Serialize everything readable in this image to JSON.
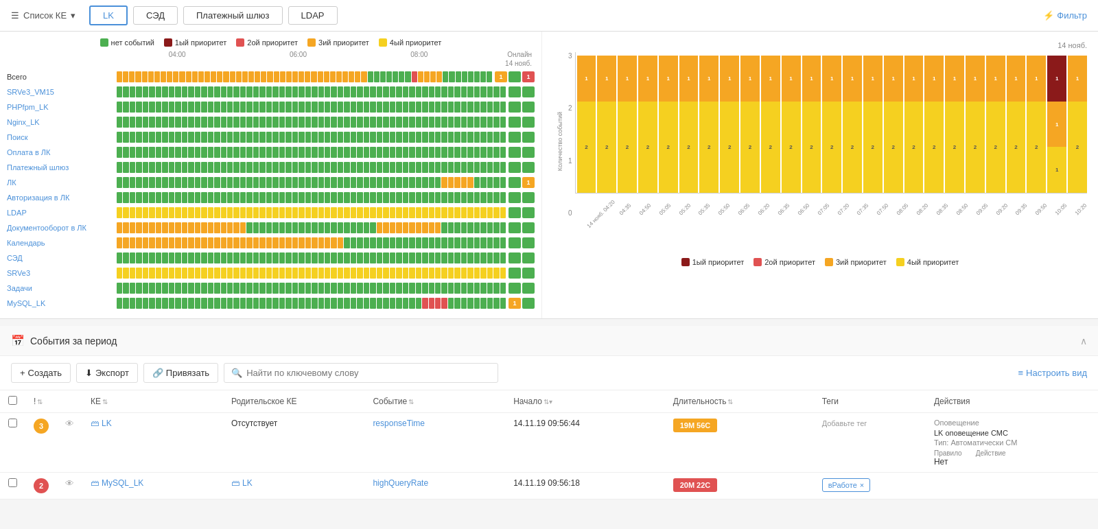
{
  "nav": {
    "brand": "Список КЕ",
    "tabs": [
      "LK",
      "СЭД",
      "Платежный шлюз",
      "LDAP"
    ],
    "active_tab": "LK",
    "filter_label": "Фильтр"
  },
  "heatmap": {
    "legend": [
      {
        "label": "нет событий",
        "color": "#4caf50"
      },
      {
        "label": "1ый приоритет",
        "color": "#8b1a1a"
      },
      {
        "label": "2ой приоритет",
        "color": "#e05252"
      },
      {
        "label": "3ий приоритет",
        "color": "#f5a623"
      },
      {
        "label": "4ый приоритет",
        "color": "#f5d020"
      }
    ],
    "times": [
      "04:00",
      "06:00",
      "08:00"
    ],
    "date": "14 нояб.",
    "online_label": "Онлайн",
    "rows": [
      {
        "name": "Всего",
        "is_all": true,
        "pattern": "mixed_all",
        "online": [
          {
            "color": "#f5a623",
            "label": "1"
          },
          {
            "color": "#4caf50",
            "label": ""
          },
          {
            "color": "#e05252",
            "label": "1"
          }
        ]
      },
      {
        "name": "SRVe3_VM15",
        "pattern": "green",
        "online": [
          {
            "color": "#4caf50",
            "label": ""
          },
          {
            "color": "#4caf50",
            "label": ""
          }
        ]
      },
      {
        "name": "PHPfpm_LK",
        "pattern": "green",
        "online": [
          {
            "color": "#4caf50",
            "label": ""
          },
          {
            "color": "#4caf50",
            "label": ""
          }
        ]
      },
      {
        "name": "Nginx_LK",
        "pattern": "green",
        "online": [
          {
            "color": "#4caf50",
            "label": ""
          },
          {
            "color": "#4caf50",
            "label": ""
          }
        ]
      },
      {
        "name": "Поиск",
        "pattern": "green",
        "online": [
          {
            "color": "#4caf50",
            "label": ""
          },
          {
            "color": "#4caf50",
            "label": ""
          }
        ]
      },
      {
        "name": "Оплата в ЛК",
        "pattern": "green",
        "online": [
          {
            "color": "#4caf50",
            "label": ""
          },
          {
            "color": "#4caf50",
            "label": ""
          }
        ]
      },
      {
        "name": "Платежный шлюз",
        "pattern": "green",
        "online": [
          {
            "color": "#4caf50",
            "label": ""
          },
          {
            "color": "#4caf50",
            "label": ""
          }
        ]
      },
      {
        "name": "ЛК",
        "pattern": "green_with_orange",
        "online": [
          {
            "color": "#4caf50",
            "label": ""
          },
          {
            "color": "#f5a623",
            "label": "1"
          }
        ]
      },
      {
        "name": "Авторизация в ЛК",
        "pattern": "green",
        "online": [
          {
            "color": "#4caf50",
            "label": ""
          },
          {
            "color": "#4caf50",
            "label": ""
          }
        ]
      },
      {
        "name": "LDAP",
        "pattern": "yellow",
        "online": [
          {
            "color": "#4caf50",
            "label": ""
          },
          {
            "color": "#4caf50",
            "label": ""
          }
        ]
      },
      {
        "name": "Документооборот в ЛК",
        "pattern": "mixed_orange_green",
        "online": [
          {
            "color": "#4caf50",
            "label": ""
          },
          {
            "color": "#4caf50",
            "label": ""
          }
        ]
      },
      {
        "name": "Календарь",
        "pattern": "mixed_orange_green2",
        "online": [
          {
            "color": "#4caf50",
            "label": ""
          },
          {
            "color": "#4caf50",
            "label": ""
          }
        ]
      },
      {
        "name": "СЭД",
        "pattern": "green",
        "online": [
          {
            "color": "#4caf50",
            "label": ""
          },
          {
            "color": "#4caf50",
            "label": ""
          }
        ]
      },
      {
        "name": "SRVe3",
        "pattern": "yellow",
        "online": [
          {
            "color": "#4caf50",
            "label": ""
          },
          {
            "color": "#4caf50",
            "label": ""
          }
        ]
      },
      {
        "name": "Задачи",
        "pattern": "green",
        "online": [
          {
            "color": "#4caf50",
            "label": ""
          },
          {
            "color": "#4caf50",
            "label": ""
          }
        ]
      },
      {
        "name": "MySQL_LK",
        "pattern": "green_with_red",
        "online": [
          {
            "color": "#f5a623",
            "label": "1"
          },
          {
            "color": "#4caf50",
            "label": ""
          }
        ]
      }
    ]
  },
  "chart": {
    "date": "14 нояб.",
    "y_labels": [
      "3",
      "2",
      "1",
      "0"
    ],
    "x_labels": [
      "14 нояб. 04:20",
      "04:35",
      "04:50",
      "05:05",
      "05:20",
      "05:35",
      "05:50",
      "06:05",
      "06:20",
      "06:35",
      "06:50",
      "07:05",
      "07:20",
      "07:35",
      "07:50",
      "08:05",
      "08:20",
      "08:35",
      "08:50",
      "09:05",
      "09:20",
      "09:35",
      "09:50",
      "10:05",
      "10:20"
    ],
    "bars": [
      {
        "p4": 2,
        "p3": 1,
        "p2": 0,
        "p1": 0
      },
      {
        "p4": 2,
        "p3": 1,
        "p2": 0,
        "p1": 0
      },
      {
        "p4": 2,
        "p3": 1,
        "p2": 0,
        "p1": 0
      },
      {
        "p4": 2,
        "p3": 1,
        "p2": 0,
        "p1": 0
      },
      {
        "p4": 2,
        "p3": 1,
        "p2": 0,
        "p1": 0
      },
      {
        "p4": 2,
        "p3": 1,
        "p2": 0,
        "p1": 0
      },
      {
        "p4": 2,
        "p3": 1,
        "p2": 0,
        "p1": 0
      },
      {
        "p4": 2,
        "p3": 1,
        "p2": 0,
        "p1": 0
      },
      {
        "p4": 2,
        "p3": 1,
        "p2": 0,
        "p1": 0
      },
      {
        "p4": 2,
        "p3": 1,
        "p2": 0,
        "p1": 0
      },
      {
        "p4": 2,
        "p3": 1,
        "p2": 0,
        "p1": 0
      },
      {
        "p4": 2,
        "p3": 1,
        "p2": 0,
        "p1": 0
      },
      {
        "p4": 2,
        "p3": 1,
        "p2": 0,
        "p1": 0
      },
      {
        "p4": 2,
        "p3": 1,
        "p2": 0,
        "p1": 0
      },
      {
        "p4": 2,
        "p3": 1,
        "p2": 0,
        "p1": 0
      },
      {
        "p4": 2,
        "p3": 1,
        "p2": 0,
        "p1": 0
      },
      {
        "p4": 2,
        "p3": 1,
        "p2": 0,
        "p1": 0
      },
      {
        "p4": 2,
        "p3": 1,
        "p2": 0,
        "p1": 0
      },
      {
        "p4": 2,
        "p3": 1,
        "p2": 0,
        "p1": 0
      },
      {
        "p4": 2,
        "p3": 1,
        "p2": 0,
        "p1": 0
      },
      {
        "p4": 2,
        "p3": 1,
        "p2": 0,
        "p1": 0
      },
      {
        "p4": 2,
        "p3": 1,
        "p2": 0,
        "p1": 0
      },
      {
        "p4": 2,
        "p3": 1,
        "p2": 0,
        "p1": 0
      },
      {
        "p4": 1,
        "p3": 1,
        "p2": 0,
        "p1": 1
      },
      {
        "p4": 2,
        "p3": 1,
        "p2": 0,
        "p1": 0
      }
    ],
    "legend": [
      {
        "label": "1ый приоритет",
        "color": "#8b1a1a"
      },
      {
        "label": "2ой приоритет",
        "color": "#e05252"
      },
      {
        "label": "3ий приоритет",
        "color": "#f5a623"
      },
      {
        "label": "4ый приоритет",
        "color": "#f5d020"
      }
    ],
    "y_axis_label": "Количество событий"
  },
  "events": {
    "section_title": "События за период",
    "toolbar": {
      "create_label": "Создать",
      "export_label": "Экспорт",
      "bind_label": "Привязать",
      "search_placeholder": "Найти по ключевому слову",
      "customize_label": "Настроить вид"
    },
    "table_headers": [
      "",
      "",
      "",
      "КЕ",
      "",
      "Родительское КЕ",
      "Событие",
      "",
      "Начало",
      "",
      "Длительность",
      "",
      "Теги",
      "Действия"
    ],
    "rows": [
      {
        "priority": "3",
        "priority_color": "#f5a623",
        "ke": "LK",
        "parent_ke": "Отсутствует",
        "event": "responseTime",
        "start": "14.11.19 09:56:44",
        "duration": "19М 56С",
        "duration_color": "#f5a623",
        "tag": "",
        "tag_label": "Добавьте тег",
        "notification_label": "Оповещение",
        "notification_name": "LK оповещение СМС",
        "notification_type": "Тип: Автоматически СМ",
        "notification_rule_label": "Правило",
        "notification_action_label": "Действие",
        "action": "Нет"
      },
      {
        "priority": "2",
        "priority_color": "#e05252",
        "ke": "MySQL_LK",
        "parent_ke": "LK",
        "event": "highQueryRate",
        "start": "14.11.19 09:56:18",
        "duration": "20М 22С",
        "duration_color": "#e05252",
        "tag": "вРаботе",
        "tag_label": "",
        "notification_label": "",
        "notification_name": "",
        "notification_type": "",
        "notification_rule_label": "",
        "notification_action_label": "",
        "action": ""
      }
    ]
  }
}
